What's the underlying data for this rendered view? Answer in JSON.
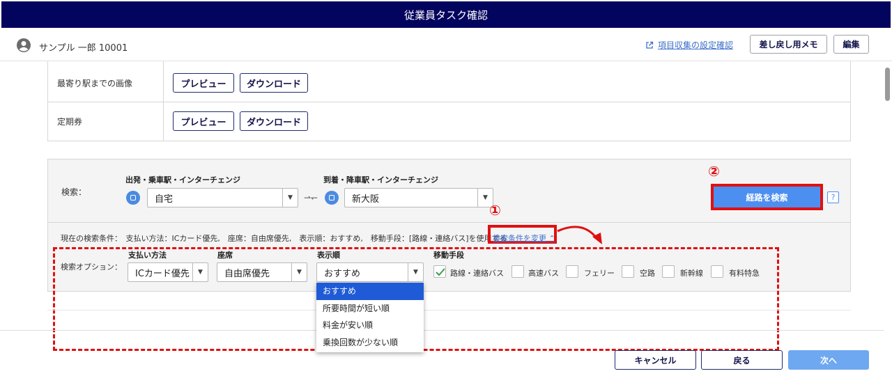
{
  "header": {
    "title": "従業員タスク確認"
  },
  "user": {
    "name": "サンプル 一郎 10001"
  },
  "toolbar": {
    "settings_link": "項目収集の設定確認",
    "memo_button": "差し戻し用メモ",
    "edit_button": "編集"
  },
  "documents": [
    {
      "label": "最寄り駅までの画像",
      "preview": "プレビュー",
      "download": "ダウンロード"
    },
    {
      "label": "定期券",
      "preview": "プレビュー",
      "download": "ダウンロード"
    }
  ],
  "search": {
    "label": "検索：",
    "departure_label": "出発・乗車駅・インターチェンジ",
    "departure_value": "自宅",
    "arrival_label": "到着・降車駅・インターチェンジ",
    "arrival_value": "新大阪",
    "search_button": "経路を検索",
    "help": "?"
  },
  "conditions": {
    "text": "現在の検索条件：　支払い方法：ICカード優先,　座席：自由席優先,　表示順：おすすめ,　移動手段：[路線・連絡バス]を使用する",
    "change_link": "検索条件を変更 ⌃"
  },
  "options": {
    "label": "検索オプション：",
    "payment_label": "支払い方法",
    "payment_value": "ICカード優先",
    "seat_label": "座席",
    "seat_value": "自由席優先",
    "order_label": "表示順",
    "order_value": "おすすめ",
    "order_options": [
      "おすすめ",
      "所要時間が短い順",
      "料金が安い順",
      "乗換回数が少ない順"
    ],
    "transport_label": "移動手段",
    "transport": [
      {
        "label": "路線・連絡バス",
        "checked": true
      },
      {
        "label": "高速バス",
        "checked": false
      },
      {
        "label": "フェリー",
        "checked": false
      },
      {
        "label": "空路",
        "checked": false
      },
      {
        "label": "新幹線",
        "checked": false
      },
      {
        "label": "有料特急",
        "checked": false
      }
    ]
  },
  "annotations": {
    "one": "①",
    "two": "②"
  },
  "footer": {
    "cancel": "キャンセル",
    "back": "戻る",
    "next": "次へ"
  },
  "colors": {
    "header": "#03045e",
    "accent": "#4d8ff0",
    "annotation": "#e01010"
  }
}
